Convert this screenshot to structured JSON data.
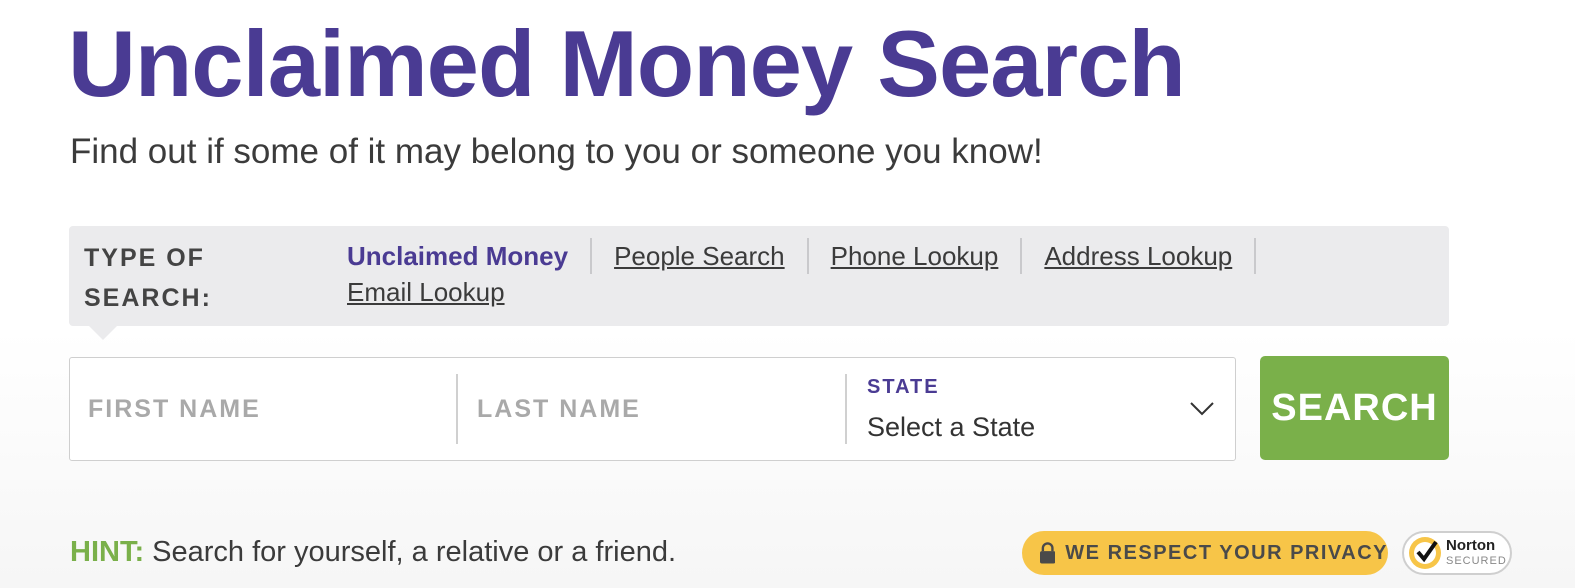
{
  "header": {
    "title": "Unclaimed Money Search",
    "subtitle": "Find out if some of it may belong to you or someone you know!"
  },
  "search_type": {
    "label": "TYPE OF SEARCH:",
    "links": [
      {
        "label": "Unclaimed Money",
        "active": true
      },
      {
        "label": "People Search",
        "active": false
      },
      {
        "label": "Phone Lookup",
        "active": false
      },
      {
        "label": "Address Lookup",
        "active": false
      },
      {
        "label": "Email Lookup",
        "active": false
      }
    ]
  },
  "form": {
    "first_name_placeholder": "FIRST NAME",
    "last_name_placeholder": "LAST NAME",
    "state_label": "STATE",
    "state_value": "Select a State",
    "search_button": "SEARCH"
  },
  "footer": {
    "hint_label": "HINT:",
    "hint_text": " Search for yourself, a relative or a friend.",
    "privacy_text": "WE RESPECT YOUR PRIVACY",
    "norton_name": "Norton",
    "norton_sub": "SECURED"
  },
  "colors": {
    "brand_purple": "#4a3b93",
    "action_green": "#7ab04a",
    "privacy_yellow": "#f7c548"
  },
  "icons": [
    "lock-icon",
    "chevron-down-icon",
    "norton-check-icon"
  ]
}
